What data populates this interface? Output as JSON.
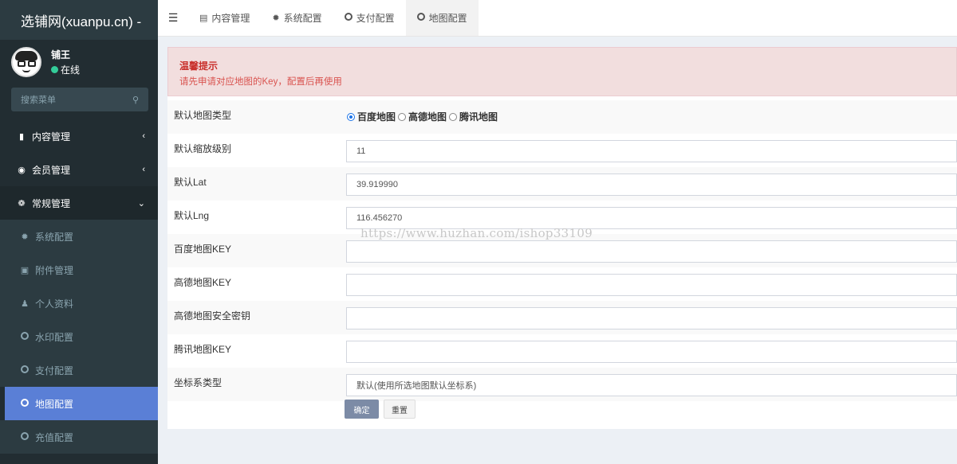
{
  "brand": {
    "title": "选铺网(xuanpu.cn) -"
  },
  "user": {
    "name": "铺王",
    "status": "在线",
    "status_color": "#33cc99"
  },
  "sidebar": {
    "search_placeholder": "搜索菜单",
    "items": [
      {
        "label": "内容管理",
        "icon": "file-icon",
        "caret": "‹"
      },
      {
        "label": "会员管理",
        "icon": "user-circle-icon",
        "caret": "‹"
      },
      {
        "label": "常规管理",
        "icon": "cogs-icon",
        "caret": "⌄"
      },
      {
        "label": "系统配置",
        "icon": "gear-icon"
      },
      {
        "label": "附件管理",
        "icon": "image-icon"
      },
      {
        "label": "个人资料",
        "icon": "person-icon"
      },
      {
        "label": "水印配置",
        "icon": "circle-icon"
      },
      {
        "label": "支付配置",
        "icon": "circle-icon"
      },
      {
        "label": "地图配置",
        "icon": "circle-icon"
      },
      {
        "label": "充值配置",
        "icon": "circle-icon"
      }
    ],
    "active_color": "#5a7fd6"
  },
  "topbar": {
    "tabs": [
      {
        "label": "内容管理",
        "icon": "file-icon"
      },
      {
        "label": "系统配置",
        "icon": "gear-icon"
      },
      {
        "label": "支付配置",
        "icon": "circle-icon"
      },
      {
        "label": "地图配置",
        "icon": "circle-icon"
      }
    ]
  },
  "alert": {
    "title": "温馨提示",
    "text": "请先申请对应地图的Key，配置后再使用"
  },
  "form": {
    "map_type": {
      "label": "默认地图类型",
      "options": [
        "百度地图",
        "高德地图",
        "腾讯地图"
      ],
      "selected": "百度地图"
    },
    "zoom": {
      "label": "默认缩放级别",
      "value": "11"
    },
    "lat": {
      "label": "默认Lat",
      "value": "39.919990"
    },
    "lng": {
      "label": "默认Lng",
      "value": "116.456270"
    },
    "baidu_key": {
      "label": "百度地图KEY",
      "value": ""
    },
    "amap_key": {
      "label": "高德地图KEY",
      "value": ""
    },
    "amap_secret": {
      "label": "高德地图安全密钥",
      "value": ""
    },
    "tencent_key": {
      "label": "腾讯地图KEY",
      "value": ""
    },
    "coord": {
      "label": "坐标系类型",
      "value": "默认(使用所选地图默认坐标系)"
    },
    "submit_label": "确定",
    "reset_label": "重置"
  },
  "watermark": "https://www.huzhan.com/ishop33109"
}
